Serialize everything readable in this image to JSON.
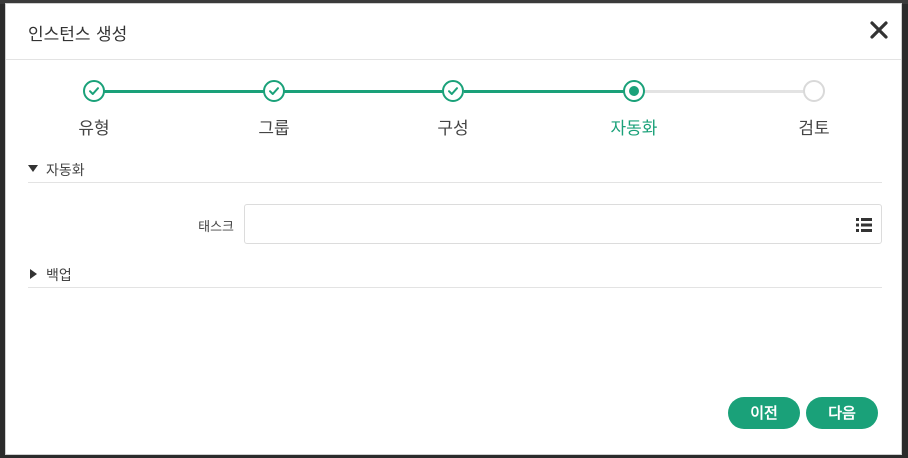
{
  "dialog": {
    "title": "인스턴스 생성",
    "close_icon": "close-icon"
  },
  "stepper": {
    "steps": [
      {
        "label": "유형",
        "state": "done"
      },
      {
        "label": "그룹",
        "state": "done"
      },
      {
        "label": "구성",
        "state": "done"
      },
      {
        "label": "자동화",
        "state": "current"
      },
      {
        "label": "검토",
        "state": "todo"
      }
    ]
  },
  "sections": {
    "automation": {
      "label": "자동화",
      "expanded": true
    },
    "backup": {
      "label": "백업",
      "expanded": false
    }
  },
  "task_field": {
    "label": "태스크",
    "value": "",
    "icon": "list-icon"
  },
  "footer": {
    "prev_label": "이전",
    "next_label": "다음"
  },
  "colors": {
    "accent": "#1aa179",
    "inactive": "#d9d9d9"
  }
}
